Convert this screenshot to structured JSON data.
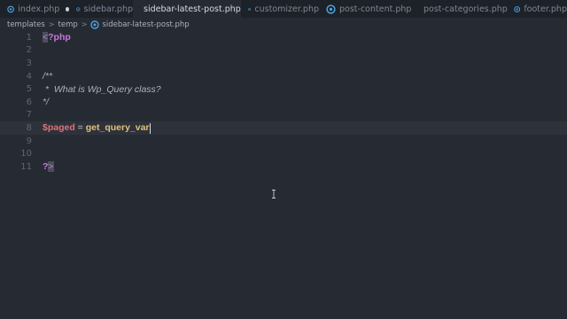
{
  "tabs": [
    {
      "label": "index.php",
      "dirty": true,
      "active": false,
      "icon": "file-code-icon"
    },
    {
      "label": "sidebar.php",
      "dirty": false,
      "active": false,
      "icon": "file-code-icon"
    },
    {
      "label": "sidebar-latest-post.php",
      "dirty": true,
      "active": true,
      "icon": "file-code-icon"
    },
    {
      "label": "customizer.php",
      "dirty": false,
      "active": false,
      "icon": "file-code-icon"
    },
    {
      "label": "post-content.php",
      "dirty": false,
      "active": false,
      "icon": "file-code-icon"
    },
    {
      "label": "post-categories.php",
      "dirty": false,
      "active": false,
      "icon": "file-code-icon"
    },
    {
      "label": "footer.php",
      "dirty": false,
      "active": false,
      "icon": "file-code-icon"
    }
  ],
  "breadcrumb": {
    "items": [
      "templates",
      "temp"
    ],
    "file": "sidebar-latest-post.php",
    "separator": ">"
  },
  "editor": {
    "current_line": 8,
    "lines": [
      {
        "n": "1",
        "tokens": [
          {
            "cls": "t-bracket",
            "text": "<"
          },
          {
            "cls": "t-php",
            "text": "?php"
          }
        ]
      },
      {
        "n": "2",
        "tokens": []
      },
      {
        "n": "3",
        "tokens": []
      },
      {
        "n": "4",
        "tokens": [
          {
            "cls": "t-comment",
            "text": "/**"
          }
        ]
      },
      {
        "n": "5",
        "tokens": [
          {
            "cls": "t-comment",
            "text": " *  What is Wp_Query class?"
          }
        ]
      },
      {
        "n": "6",
        "tokens": [
          {
            "cls": "t-comment",
            "text": "*/"
          }
        ]
      },
      {
        "n": "7",
        "tokens": []
      },
      {
        "n": "8",
        "tokens": [
          {
            "cls": "t-var",
            "text": "$paged"
          },
          {
            "cls": "t-op",
            "text": " = "
          },
          {
            "cls": "t-fn",
            "text": "get_query_var"
          }
        ]
      },
      {
        "n": "9",
        "tokens": []
      },
      {
        "n": "10",
        "tokens": []
      },
      {
        "n": "11",
        "tokens": [
          {
            "cls": "t-php",
            "text": "?"
          },
          {
            "cls": "t-bracket",
            "text": ">"
          }
        ]
      }
    ]
  },
  "colors": {
    "background": "#262b33",
    "tabbar": "#1d2128",
    "php_keyword": "#c678dd",
    "variable": "#e0707a",
    "function": "#e5c07b",
    "file_icon": "#4aa3df"
  }
}
